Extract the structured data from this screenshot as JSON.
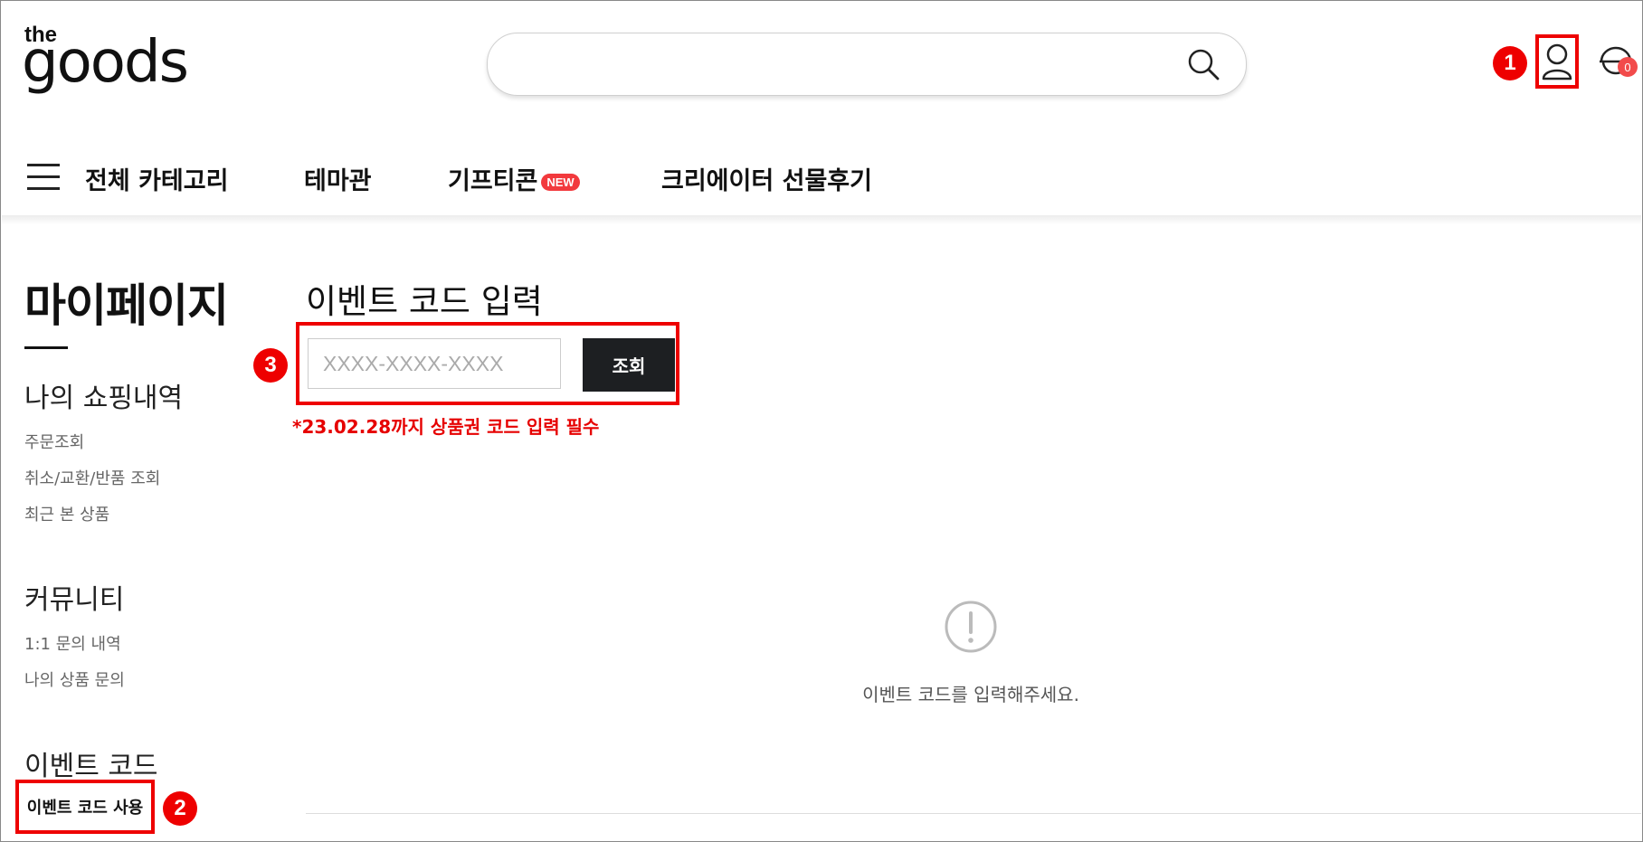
{
  "header": {
    "logo": {
      "line1": "the",
      "line2": "goods"
    },
    "search": {
      "placeholder": "",
      "icon": "search-icon"
    },
    "user_icon": "user-icon",
    "cart": {
      "icon": "cart-icon",
      "count": "0"
    },
    "markers": {
      "user": "1"
    }
  },
  "nav": {
    "menu_icon": "hamburger-icon",
    "items": [
      {
        "label": "전체 카테고리"
      },
      {
        "label": "테마관"
      },
      {
        "label": "기프티콘",
        "badge": "NEW"
      },
      {
        "label": "크리에이터 선물후기"
      }
    ]
  },
  "sidebar": {
    "title": "마이페이지",
    "sections": [
      {
        "heading": "나의 쇼핑내역",
        "links": [
          "주문조회",
          "취소/교환/반품 조회",
          "최근 본 상품"
        ]
      },
      {
        "heading": "커뮤니티",
        "links": [
          "1:1 문의 내역",
          "나의 상품 문의"
        ]
      },
      {
        "heading": "이벤트 코드",
        "links": [
          "이벤트 코드 사용"
        ]
      }
    ],
    "marker": "2"
  },
  "main": {
    "title": "이벤트 코드 입력",
    "code_input": {
      "placeholder": "XXXX-XXXX-XXXX",
      "value": ""
    },
    "submit_label": "조회",
    "marker": "3",
    "notice": "*23.02.28까지 상품권 코드 입력 필수",
    "empty": {
      "icon": "exclamation-circle-icon",
      "text": "이벤트 코드를 입력해주세요."
    }
  },
  "colors": {
    "highlight": "#ee0000",
    "badge": "#f2393d",
    "button": "#1d1f22",
    "notice": "#e60000"
  }
}
